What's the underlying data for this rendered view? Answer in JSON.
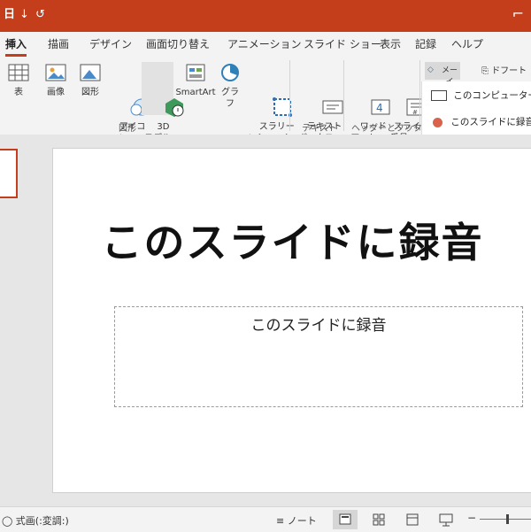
{
  "titlebar": {
    "app_glyph": "日",
    "undo_glyph": "↓",
    "redo_glyph": "↺",
    "close_glyph": "⌐"
  },
  "tabs": [
    "挿入",
    "描画",
    "デザイン",
    "画面切り替え",
    "アニメーション",
    "スライド ショー",
    "表示",
    "記録",
    "ヘルプ"
  ],
  "active_tab": "挿入",
  "ribbon": {
    "table": "表",
    "image": "画像",
    "shapes": "図形",
    "icons": "アイコ\nン",
    "model3d": "3D\nモデル",
    "smartart": "SmartArt",
    "chart": "グラフ",
    "slide_zoom": "スラリー\nンショット",
    "textbox": "テキスト\nボックス",
    "wordart": "ワード\nアート",
    "slide_number": "スライド\n番号",
    "group_shapes": "図形",
    "group_text": "テキスト",
    "group_header_footer": "ヘッダーとフッター",
    "comment": "メーイ",
    "draft": "ドフート"
  },
  "recording_panel": {
    "option_computer": "このコンピューター上と",
    "option_slide": "このスライドに録音",
    "accent": "#d9634a"
  },
  "slide": {
    "title": "このスライドに録音",
    "subtitle": "このスライドに録音"
  },
  "statusbar": {
    "left_text": "◯ 式画(:変調:)",
    "notes_label": "ノート"
  },
  "colors": {
    "brand": "#c43e1c"
  }
}
